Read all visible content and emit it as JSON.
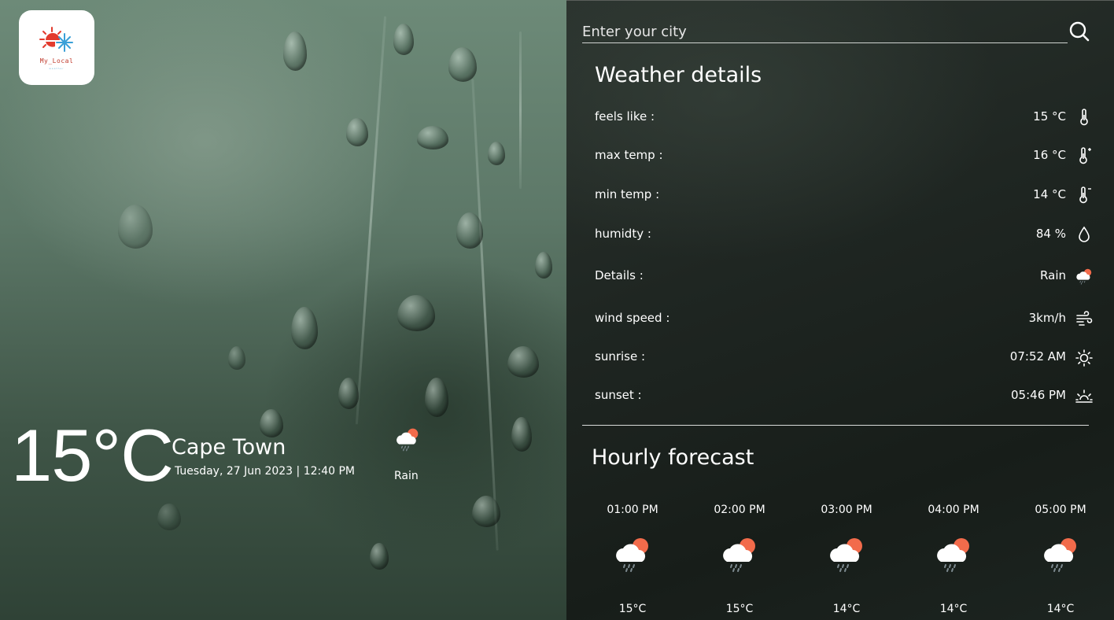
{
  "app": {
    "logo_text": "My_Local",
    "logo_subtext": "weather"
  },
  "search": {
    "placeholder": "Enter your city",
    "value": ""
  },
  "current": {
    "temperature": "15°C",
    "city": "Cape Town",
    "datetime": "Tuesday, 27 Jun 2023 | 12:40 PM",
    "condition": "Rain",
    "icon": "rain-cloud-sun-icon"
  },
  "details": {
    "title": "Weather details",
    "rows": [
      {
        "label": "feels like :",
        "value": "15 °C",
        "icon": "thermometer-icon"
      },
      {
        "label": "max temp :",
        "value": "16 °C",
        "icon": "thermometer-plus-icon"
      },
      {
        "label": "min temp :",
        "value": "14 °C",
        "icon": "thermometer-minus-icon"
      },
      {
        "label": "humidty :",
        "value": "84 %",
        "icon": "droplet-icon"
      },
      {
        "label": "Details :",
        "value": "Rain",
        "icon": "rain-cloud-sun-icon"
      },
      {
        "label": "wind speed :",
        "value": "3km/h",
        "icon": "wind-icon"
      },
      {
        "label": "sunrise :",
        "value": "07:52 AM",
        "icon": "sunrise-icon"
      },
      {
        "label": "sunset :",
        "value": "05:46 PM",
        "icon": "sunset-icon"
      }
    ]
  },
  "hourly": {
    "title": "Hourly forecast",
    "items": [
      {
        "time": "01:00 PM",
        "temp": "15°C",
        "icon": "rain-cloud-sun-icon"
      },
      {
        "time": "02:00 PM",
        "temp": "15°C",
        "icon": "rain-cloud-sun-icon"
      },
      {
        "time": "03:00 PM",
        "temp": "14°C",
        "icon": "rain-cloud-sun-icon"
      },
      {
        "time": "04:00 PM",
        "temp": "14°C",
        "icon": "rain-cloud-sun-icon"
      },
      {
        "time": "05:00 PM",
        "temp": "14°C",
        "icon": "rain-cloud-sun-icon"
      }
    ]
  },
  "colors": {
    "cloud": "#ffffff",
    "sun": "#f26b4b",
    "rain": "#7d8a90",
    "accent_text": "#ffffff"
  }
}
